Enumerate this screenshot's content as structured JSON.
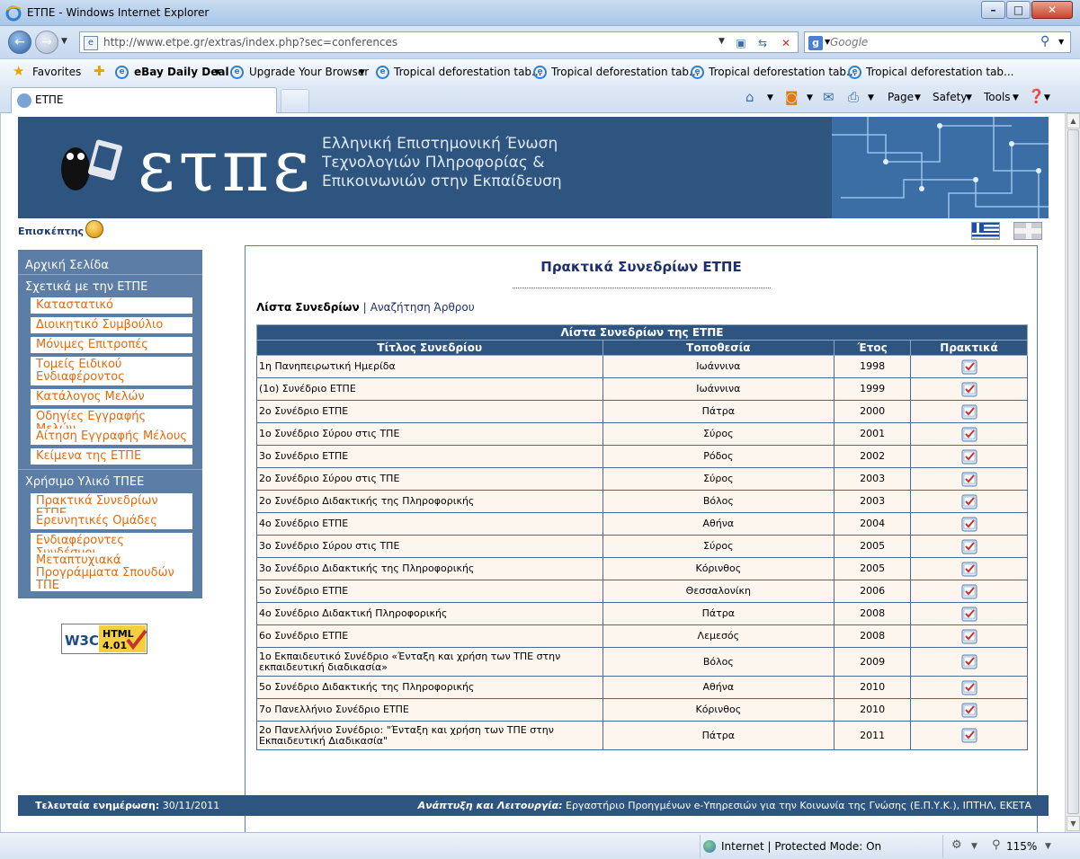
{
  "window": {
    "title": "ΕΤΠΕ - Windows Internet Explorer"
  },
  "address": {
    "url": "http://www.etpe.gr/extras/index.php?sec=conferences",
    "search_placeholder": "Google"
  },
  "favorites": {
    "favorites_label": "Favorites",
    "items": [
      "eBay Daily Deal",
      "Upgrade Your Browser",
      "Tropical deforestation tab...",
      "Tropical deforestation tab...",
      "Tropical deforestation tab...",
      "Tropical deforestation tab..."
    ]
  },
  "tabs": {
    "active": "ΕΤΠΕ"
  },
  "commandbar": {
    "page": "Page",
    "safety": "Safety",
    "tools": "Tools"
  },
  "banner": {
    "logo_text": "ετπε",
    "subtitle_1": "Ελληνική Επιστημονική Ένωση",
    "subtitle_2": "Τεχνολογιών Πληροφορίας &",
    "subtitle_3": "Επικοινωνιών στην Εκπαίδευση"
  },
  "visitor_label": "Επισκέπτης",
  "sidebar": {
    "home": "Αρχική Σελίδα",
    "section1": "Σχετικά με την ΕΤΠΕ",
    "section1_items": [
      "Καταστατικό",
      "Διοικητικό Συμβούλιο",
      "Μόνιμες Επιτροπές",
      "Τομείς Ειδικού Ενδιαφέροντος",
      "Κατάλογος Μελών",
      "Οδηγίες Εγγραφής Μελών",
      "Αίτηση Εγγραφής Μέλους",
      "Κείμενα της ΕΤΠΕ"
    ],
    "section2": "Χρήσιμο Υλικό ΤΠΕΕ",
    "section2_items": [
      "Πρακτικά Συνεδρίων ΕΤΠΕ",
      "Ερευνητικές Ομάδες",
      "Ενδιαφέροντες Συνδέσμοι",
      "Μεταπτυχιακά Προγράμματα Σπουδών ΤΠΕ"
    ]
  },
  "w3c": {
    "w3c": "W3C",
    "html": "HTML",
    "version": "4.01"
  },
  "main": {
    "heading": "Πρακτικά Συνεδρίων ΕΤΠΕ",
    "subnav_current": "Λίστα Συνεδρίων",
    "subnav_sep": "|",
    "subnav_link": "Αναζήτηση Άρθρου"
  },
  "table": {
    "caption": "Λίστα Συνεδρίων της ΕΤΠΕ",
    "columns": [
      "Τίτλος Συνεδρίου",
      "Τοποθεσία",
      "Έτος",
      "Πρακτικά"
    ],
    "rows": [
      [
        "1η Πανηπειρωτική Ημερίδα",
        "Ιωάννινα",
        "1998"
      ],
      [
        "(1ο) Συνέδριο ΕΤΠΕ",
        "Ιωάννινα",
        "1999"
      ],
      [
        "2ο Συνέδριο ΕΤΠΕ",
        "Πάτρα",
        "2000"
      ],
      [
        "1ο Συνέδριο Σύρου στις ΤΠΕ",
        "Σύρος",
        "2001"
      ],
      [
        "3ο Συνέδριο ΕΤΠΕ",
        "Ρόδος",
        "2002"
      ],
      [
        "2ο Συνέδριο Σύρου στις ΤΠΕ",
        "Σύρος",
        "2003"
      ],
      [
        "2ο Συνέδριο Διδακτικής της Πληροφορικής",
        "Βόλος",
        "2003"
      ],
      [
        "4ο Συνέδριο ΕΤΠΕ",
        "Αθήνα",
        "2004"
      ],
      [
        "3ο Συνέδριο Σύρου στις ΤΠΕ",
        "Σύρος",
        "2005"
      ],
      [
        "3ο Συνέδριο Διδακτικής της Πληροφορικής",
        "Κόρινθος",
        "2005"
      ],
      [
        "5ο Συνέδριο ΕΤΠΕ",
        "Θεσσαλονίκη",
        "2006"
      ],
      [
        "4ο Συνέδριο Διδακτική Πληροφορικής",
        "Πάτρα",
        "2008"
      ],
      [
        "6ο Συνέδριο ΕΤΠΕ",
        "Λεμεσός",
        "2008"
      ],
      [
        "1ο Εκπαιδευτικό Συνέδριο «Ένταξη και χρήση των ΤΠΕ στην εκπαιδευτική διαδικασία»",
        "Βόλος",
        "2009"
      ],
      [
        "5ο Συνέδριο Διδακτικής της Πληροφορικής",
        "Αθήνα",
        "2010"
      ],
      [
        "7ο Πανελλήνιο Συνέδριο ΕΤΠΕ",
        "Κόρινθος",
        "2010"
      ],
      [
        "2ο Πανελλήνιο Συνέδριο: \"Ένταξη και χρήση των ΤΠΕ στην Εκπαιδευτική Διαδικασία\"",
        "Πάτρα",
        "2011"
      ]
    ]
  },
  "footer": {
    "updated_label": "Τελευταία ενημέρωση:",
    "updated_value": "30/11/2011",
    "dev_label": "Ανάπτυξη και Λειτουργία:",
    "dev_value": "Εργαστήριο Προηγμένων e-Υπηρεσιών για την Κοινωνία της Γνώσης (Ε.Π.Υ.Κ.), ΙΠΤΗΛ, ΕΚΕΤΑ"
  },
  "status": {
    "zone": "Internet | Protected Mode: On",
    "zoom": "115%"
  },
  "colors": {
    "banner": "#2d5580",
    "sidebar": "#5b7da6",
    "link_orange": "#e06a10",
    "row_bg": "#fdf6ee"
  }
}
